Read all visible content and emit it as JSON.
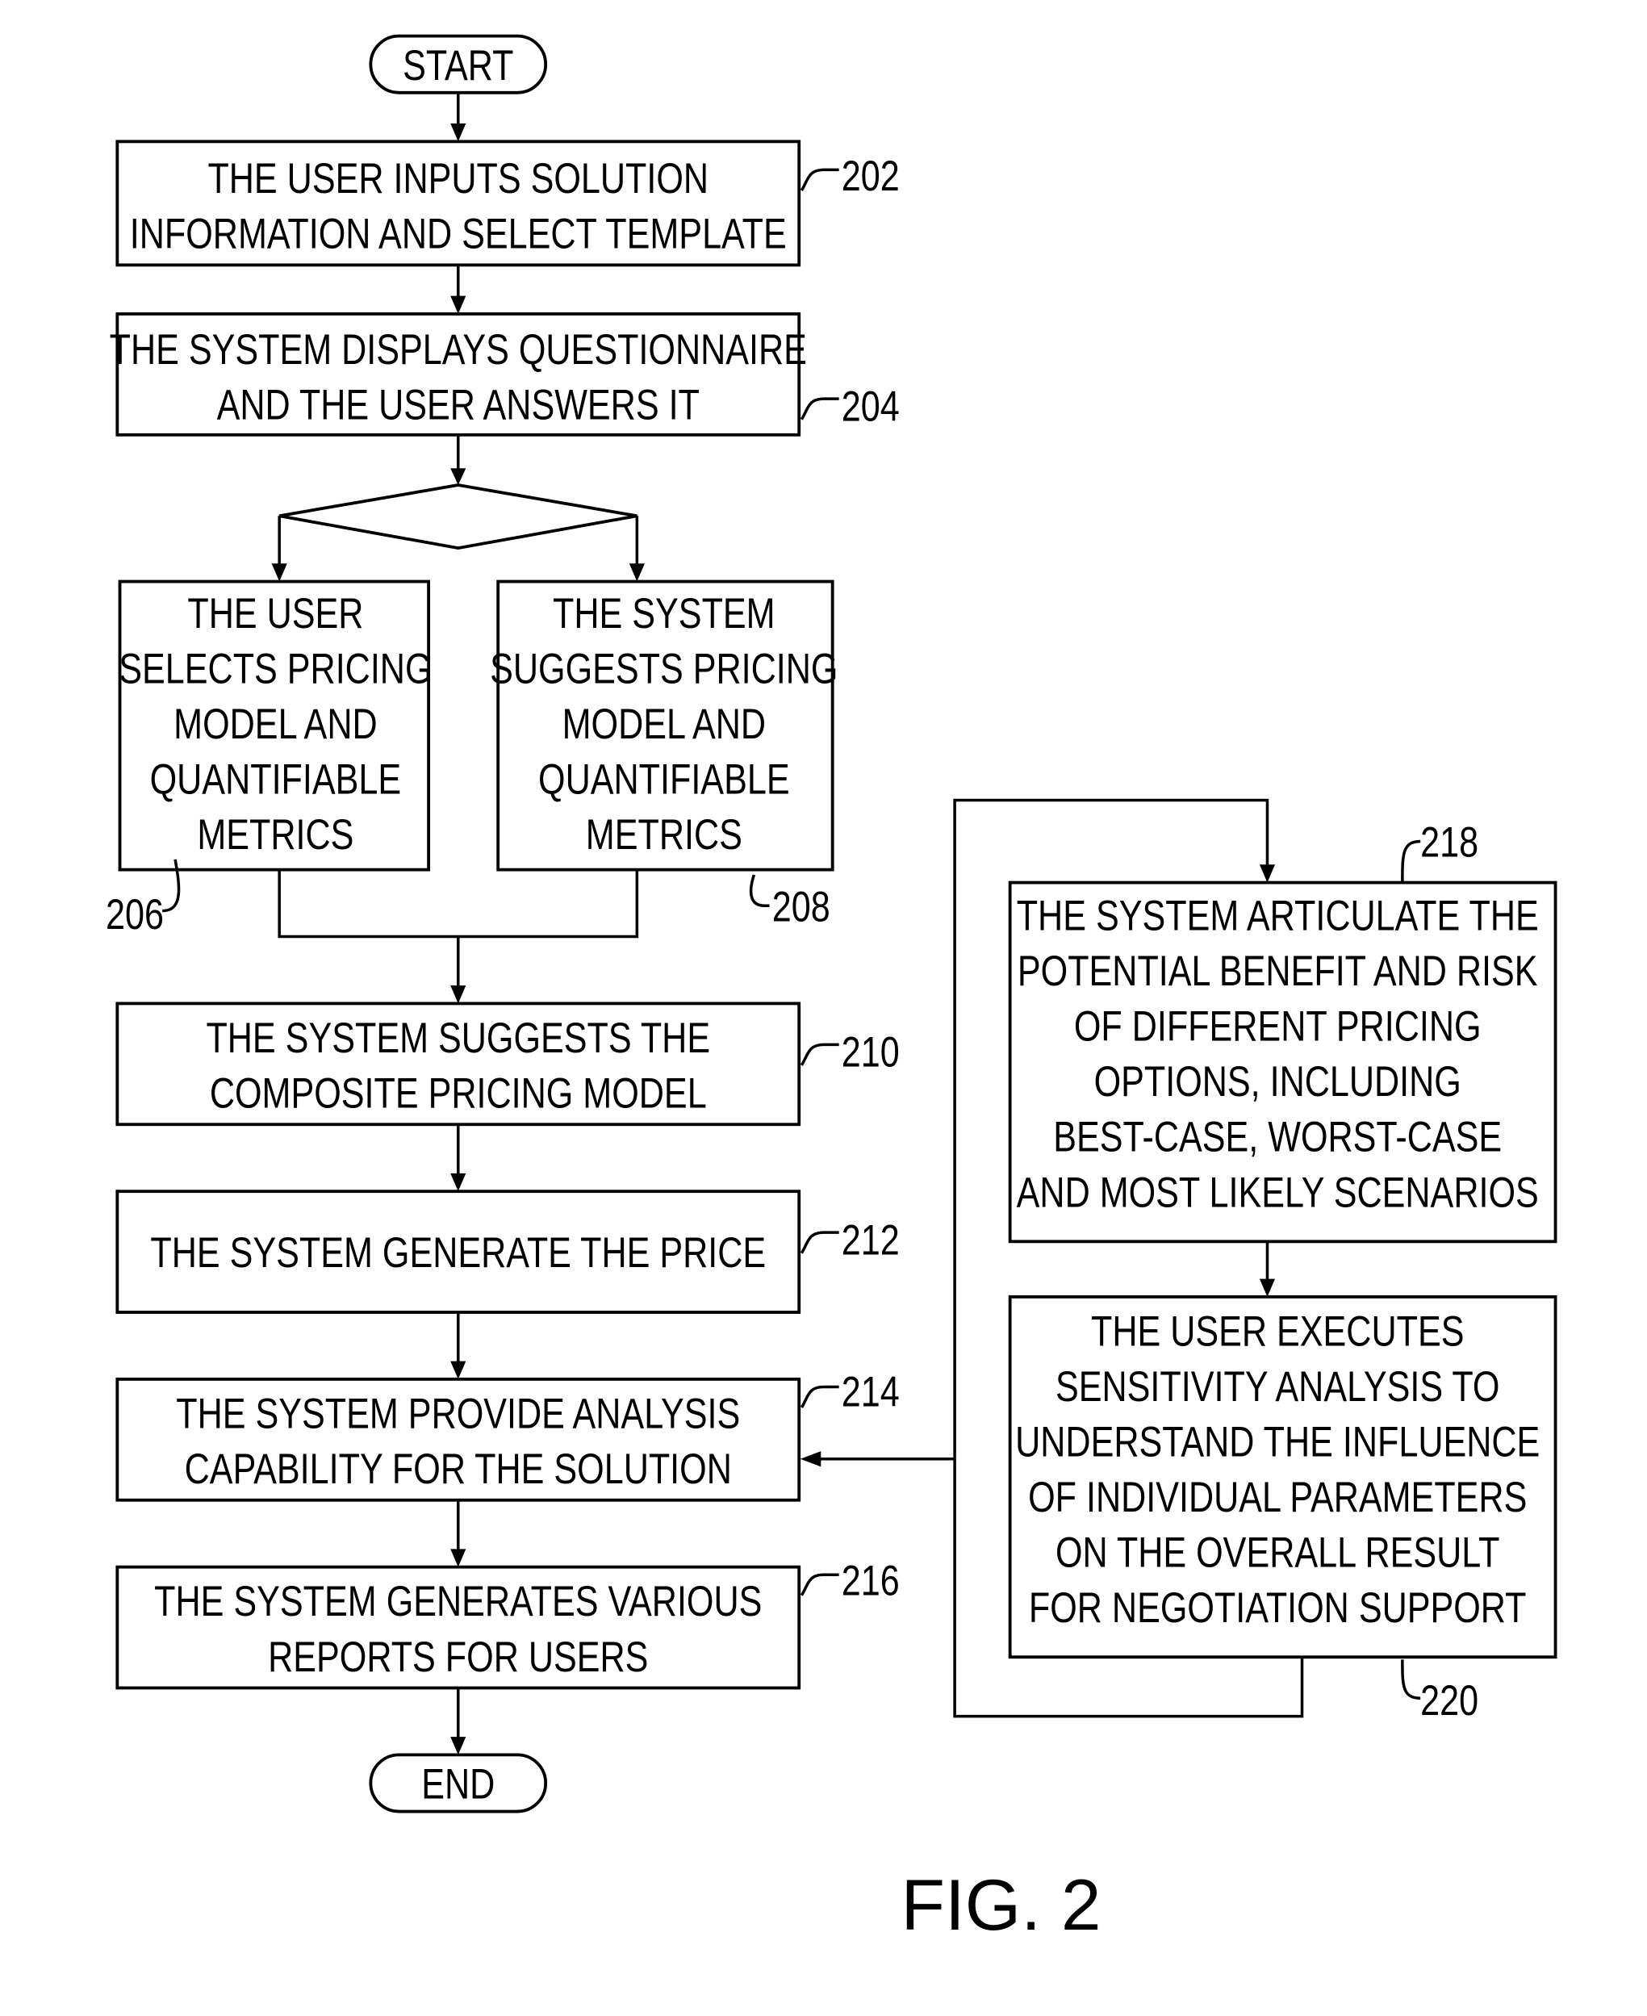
{
  "figure": {
    "caption": "FIG. 2",
    "start_label": "START",
    "end_label": "END",
    "steps": [
      {
        "ref": "202",
        "lines": [
          "THE USER INPUTS SOLUTION",
          "INFORMATION AND SELECT TEMPLATE"
        ]
      },
      {
        "ref": "204",
        "lines": [
          "THE SYSTEM DISPLAYS QUESTIONNAIRE",
          "AND THE USER ANSWERS IT"
        ]
      },
      {
        "ref": "206",
        "lines": [
          "THE USER",
          "SELECTS PRICING",
          "MODEL AND",
          "QUANTIFIABLE",
          "METRICS"
        ]
      },
      {
        "ref": "208",
        "lines": [
          "THE SYSTEM",
          "SUGGESTS PRICING",
          "MODEL AND",
          "QUANTIFIABLE",
          "METRICS"
        ]
      },
      {
        "ref": "210",
        "lines": [
          "THE SYSTEM SUGGESTS THE",
          "COMPOSITE PRICING MODEL"
        ]
      },
      {
        "ref": "212",
        "lines": [
          "THE SYSTEM GENERATE THE PRICE"
        ]
      },
      {
        "ref": "214",
        "lines": [
          "THE SYSTEM PROVIDE ANALYSIS",
          "CAPABILITY FOR THE SOLUTION"
        ]
      },
      {
        "ref": "216",
        "lines": [
          "THE SYSTEM GENERATES VARIOUS",
          "REPORTS FOR USERS"
        ]
      },
      {
        "ref": "218",
        "lines": [
          "THE SYSTEM ARTICULATE THE",
          "POTENTIAL BENEFIT AND RISK",
          "OF DIFFERENT PRICING",
          "OPTIONS, INCLUDING",
          "BEST-CASE, WORST-CASE",
          "AND MOST LIKELY SCENARIOS"
        ]
      },
      {
        "ref": "220",
        "lines": [
          "THE USER EXECUTES",
          "SENSITIVITY ANALYSIS TO",
          "UNDERSTAND THE INFLUENCE",
          "OF INDIVIDUAL PARAMETERS",
          "ON THE OVERALL RESULT",
          "FOR NEGOTIATION SUPPORT"
        ]
      }
    ]
  }
}
